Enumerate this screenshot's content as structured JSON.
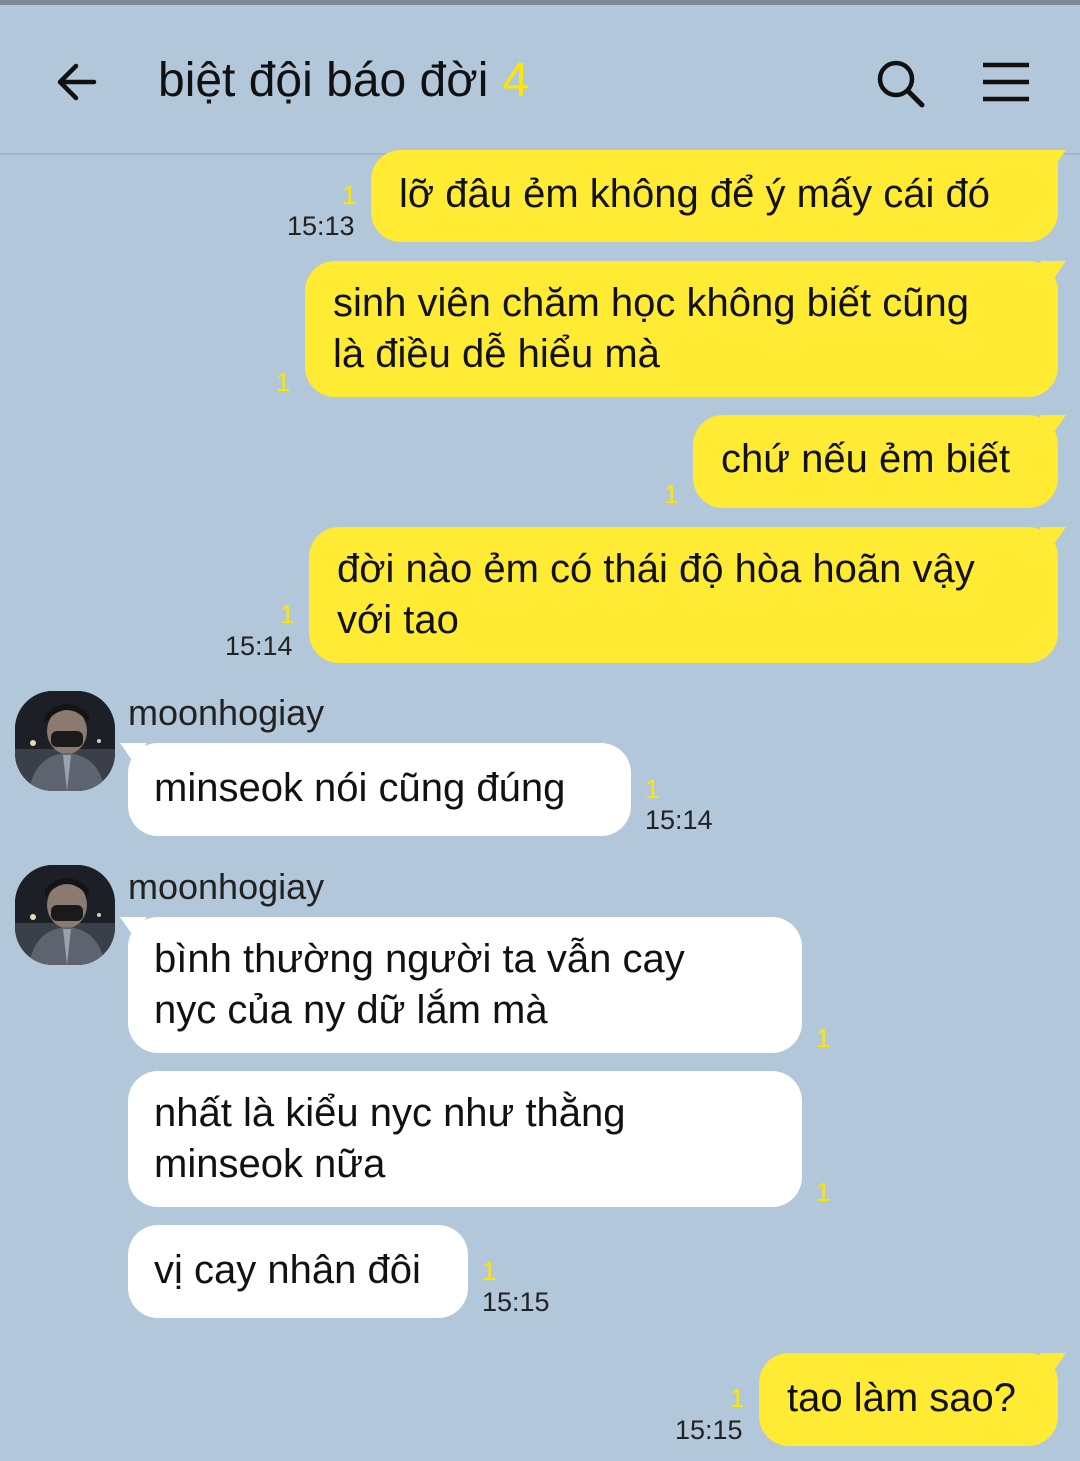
{
  "header": {
    "title": "biệt đội báo đời",
    "member_count": "4"
  },
  "messages": [
    {
      "text": "lỡ đâu ẻm không để ý mấy cái đó",
      "unread": "1",
      "time": "15:13"
    },
    {
      "line1": "sinh viên chăm học không biết cũng",
      "line2": "là điều dễ hiểu mà",
      "unread": "1"
    },
    {
      "text": "chứ nếu ẻm biết",
      "unread": "1"
    },
    {
      "line1": "đời nào ẻm có thái độ hòa hoãn vậy",
      "line2": "với tao",
      "unread": "1",
      "time": "15:14"
    },
    {
      "sender": "moonhogiay",
      "text": "minseok nói cũng đúng",
      "unread": "1",
      "time": "15:14"
    },
    {
      "sender": "moonhogiay",
      "line1": "bình thường người ta vẫn cay",
      "line2": "nyc của ny dữ lắm mà",
      "unread": "1"
    },
    {
      "line1": "nhất là kiểu nyc như thằng",
      "line2": "minseok nữa",
      "unread": "1"
    },
    {
      "text": "vị cay nhân đôi",
      "unread": "1",
      "time": "15:15"
    },
    {
      "text": "tao làm sao?",
      "unread": "1",
      "time": "15:15"
    }
  ]
}
